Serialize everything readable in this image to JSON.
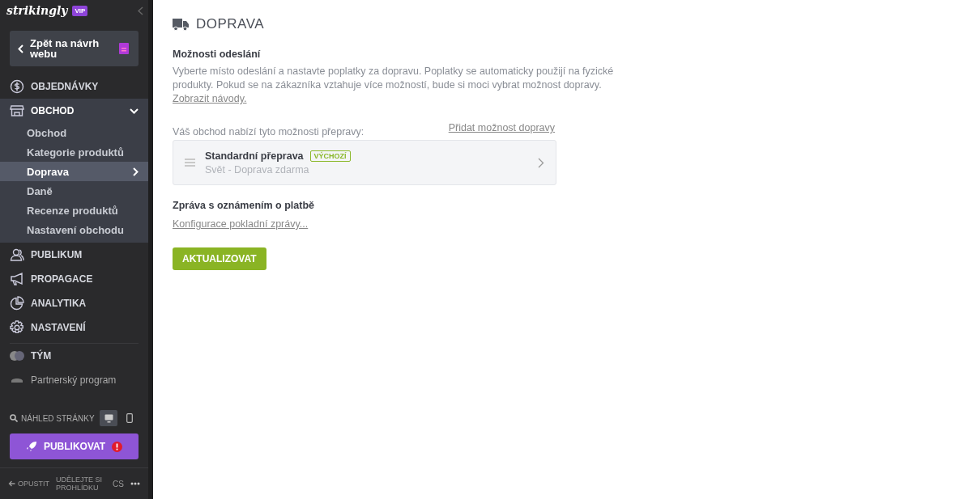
{
  "brand": {
    "logo": "strikingly",
    "badge": "VIP"
  },
  "back_button": {
    "label": "Zpět na návrh webu"
  },
  "nav": [
    {
      "label": "OBJEDNÁVKY",
      "expanded": false
    },
    {
      "label": "OBCHOD",
      "expanded": true,
      "children": [
        {
          "label": "Obchod",
          "selected": false
        },
        {
          "label": "Kategorie produktů",
          "selected": false
        },
        {
          "label": "Doprava",
          "selected": true
        },
        {
          "label": "Daně",
          "selected": false
        },
        {
          "label": "Recenze produktů",
          "selected": false
        },
        {
          "label": "Nastavení obchodu",
          "selected": false
        }
      ]
    },
    {
      "label": "PUBLIKUM",
      "expanded": false
    },
    {
      "label": "PROPAGACE",
      "expanded": false
    },
    {
      "label": "ANALYTIKA",
      "expanded": false
    },
    {
      "label": "NASTAVENÍ",
      "expanded": false
    }
  ],
  "extra_nav": [
    {
      "label": "TÝM"
    },
    {
      "label": "Partnerský program"
    }
  ],
  "preview": {
    "label": "NÁHLED STRÁNKY",
    "devices": [
      {
        "kind": "desktop",
        "selected": true
      },
      {
        "kind": "mobile",
        "selected": false
      }
    ]
  },
  "publish": {
    "label": "PUBLIKOVAT",
    "warning": true
  },
  "footer": {
    "exit": "OPUSTIT",
    "tour": "UDĚLEJTE SI PROHLÍDKU",
    "language": "CS"
  },
  "page": {
    "title": "DOPRAVA",
    "section_title": "Možnosti odeslání",
    "description": "Vyberte místo odeslání a nastavte poplatky za dopravu. Poplatky se automaticky použijí na fyzické produkty. Pokud se na zákazníka vztahuje více možností, bude si moci vybrat možnost dopravy.",
    "help_link": "Zobrazit návody.",
    "options_label": "Váš obchod nabízí tyto možnosti přepravy:",
    "add_link": "Přidat možnost dopravy",
    "shipping_options": [
      {
        "name": "Standardní přeprava",
        "badge": "VÝCHOZÍ",
        "detail": "Svět - Doprava zdarma"
      }
    ],
    "payment_title": "Zpráva s oznámením o platbě",
    "payment_link": "Konfigurace pokladní zprávy...",
    "update_button": "AKTUALIZOVAT"
  }
}
